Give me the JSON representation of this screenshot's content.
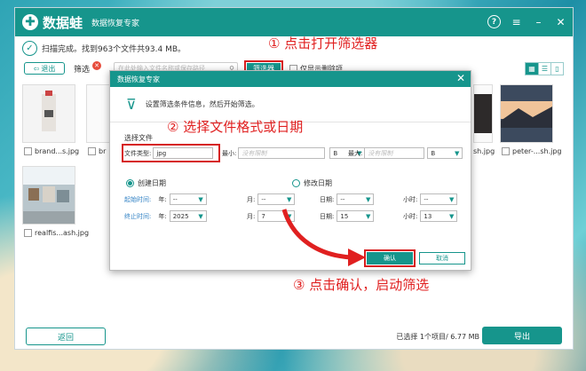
{
  "titlebar": {
    "logo_text": "数据蛙",
    "app_title": "数据恢复专家"
  },
  "status": {
    "scan_text": "扫描完成。找到963个文件共93.4 MB。"
  },
  "toolbar": {
    "exit_label": "退出",
    "filter_label": "筛选",
    "search_placeholder": "在此处输入文件名称或保存路径",
    "filter_button": "筛选器",
    "only_deleted": "仅显示删除项"
  },
  "files": [
    {
      "name": "brand...s.jpg"
    },
    {
      "name": "realfis...ash.jpg"
    },
    {
      "name": "sh.jpg"
    },
    {
      "name": "peter-...sh.jpg"
    }
  ],
  "dialog": {
    "title": "数据恢复专家",
    "header_text": "设置筛选条件信息，然后开始筛选。",
    "section_file": "选择文件",
    "file_type_label": "文件类型:",
    "file_type_value": "jpg",
    "min_label": "最小:",
    "min_placeholder": "没有限制",
    "min_unit": "B",
    "max_label": "最大:",
    "max_placeholder": "没有限制",
    "max_unit": "B",
    "radio_created": "创建日期",
    "radio_modified": "修改日期",
    "start_time_label": "起始时间:",
    "end_time_label": "终止时间:",
    "year_label": "年:",
    "month_label": "月:",
    "day_label": "日期:",
    "hour_label": "小时:",
    "start": {
      "year": "--",
      "month": "--",
      "day": "--",
      "hour": "--"
    },
    "end": {
      "year": "2025",
      "month": "7",
      "day": "15",
      "hour": "13"
    },
    "confirm": "确认",
    "cancel": "取消"
  },
  "annotations": {
    "step1": "① 点击打开筛选器",
    "step2": "② 选择文件格式或日期",
    "step3": "③ 点击确认，启动筛选"
  },
  "bottom": {
    "back": "返回",
    "selected_info": "已选择 1个项目/ 6.77 MB",
    "export": "导出"
  },
  "colors": {
    "brand": "#16958c",
    "annotation": "#e02020"
  }
}
